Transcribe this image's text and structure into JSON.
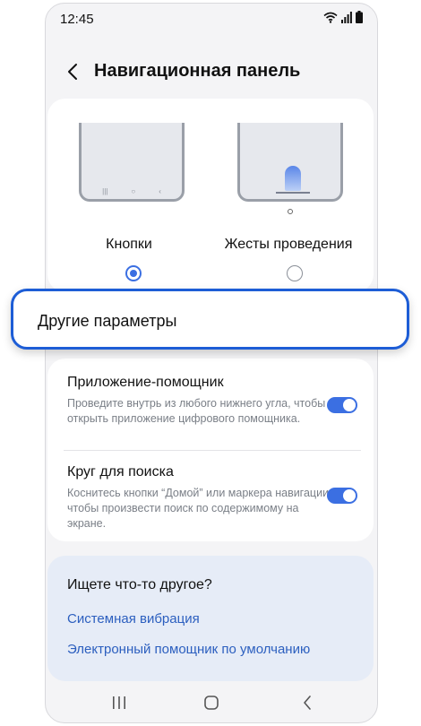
{
  "status_bar": {
    "time": "12:45"
  },
  "header": {
    "title": "Навигационная панель"
  },
  "nav_modes": [
    {
      "label": "Кнопки",
      "selected": true
    },
    {
      "label": "Жесты проведения",
      "selected": false
    }
  ],
  "other_params": {
    "label": "Другие параметры"
  },
  "options": [
    {
      "title": "Приложение-помощник",
      "description": "Проведите внутрь из любого нижнего угла, чтобы открыть приложение цифрового помощника.",
      "enabled": true
    },
    {
      "title": "Круг для поиска",
      "description": "Коснитесь кнопки “Домой” или маркера навигации, чтобы произвести поиск по содержимому на экране.",
      "enabled": true
    }
  ],
  "more": {
    "title": "Ищете что-то другое?",
    "links": [
      "Системная вибрация",
      "Электронный помощник по умолчанию"
    ]
  },
  "colors": {
    "accent": "#3b6fe2",
    "highlight_border": "#1d5dd6",
    "link": "#2c5fbf",
    "background": "#f4f4f6"
  }
}
